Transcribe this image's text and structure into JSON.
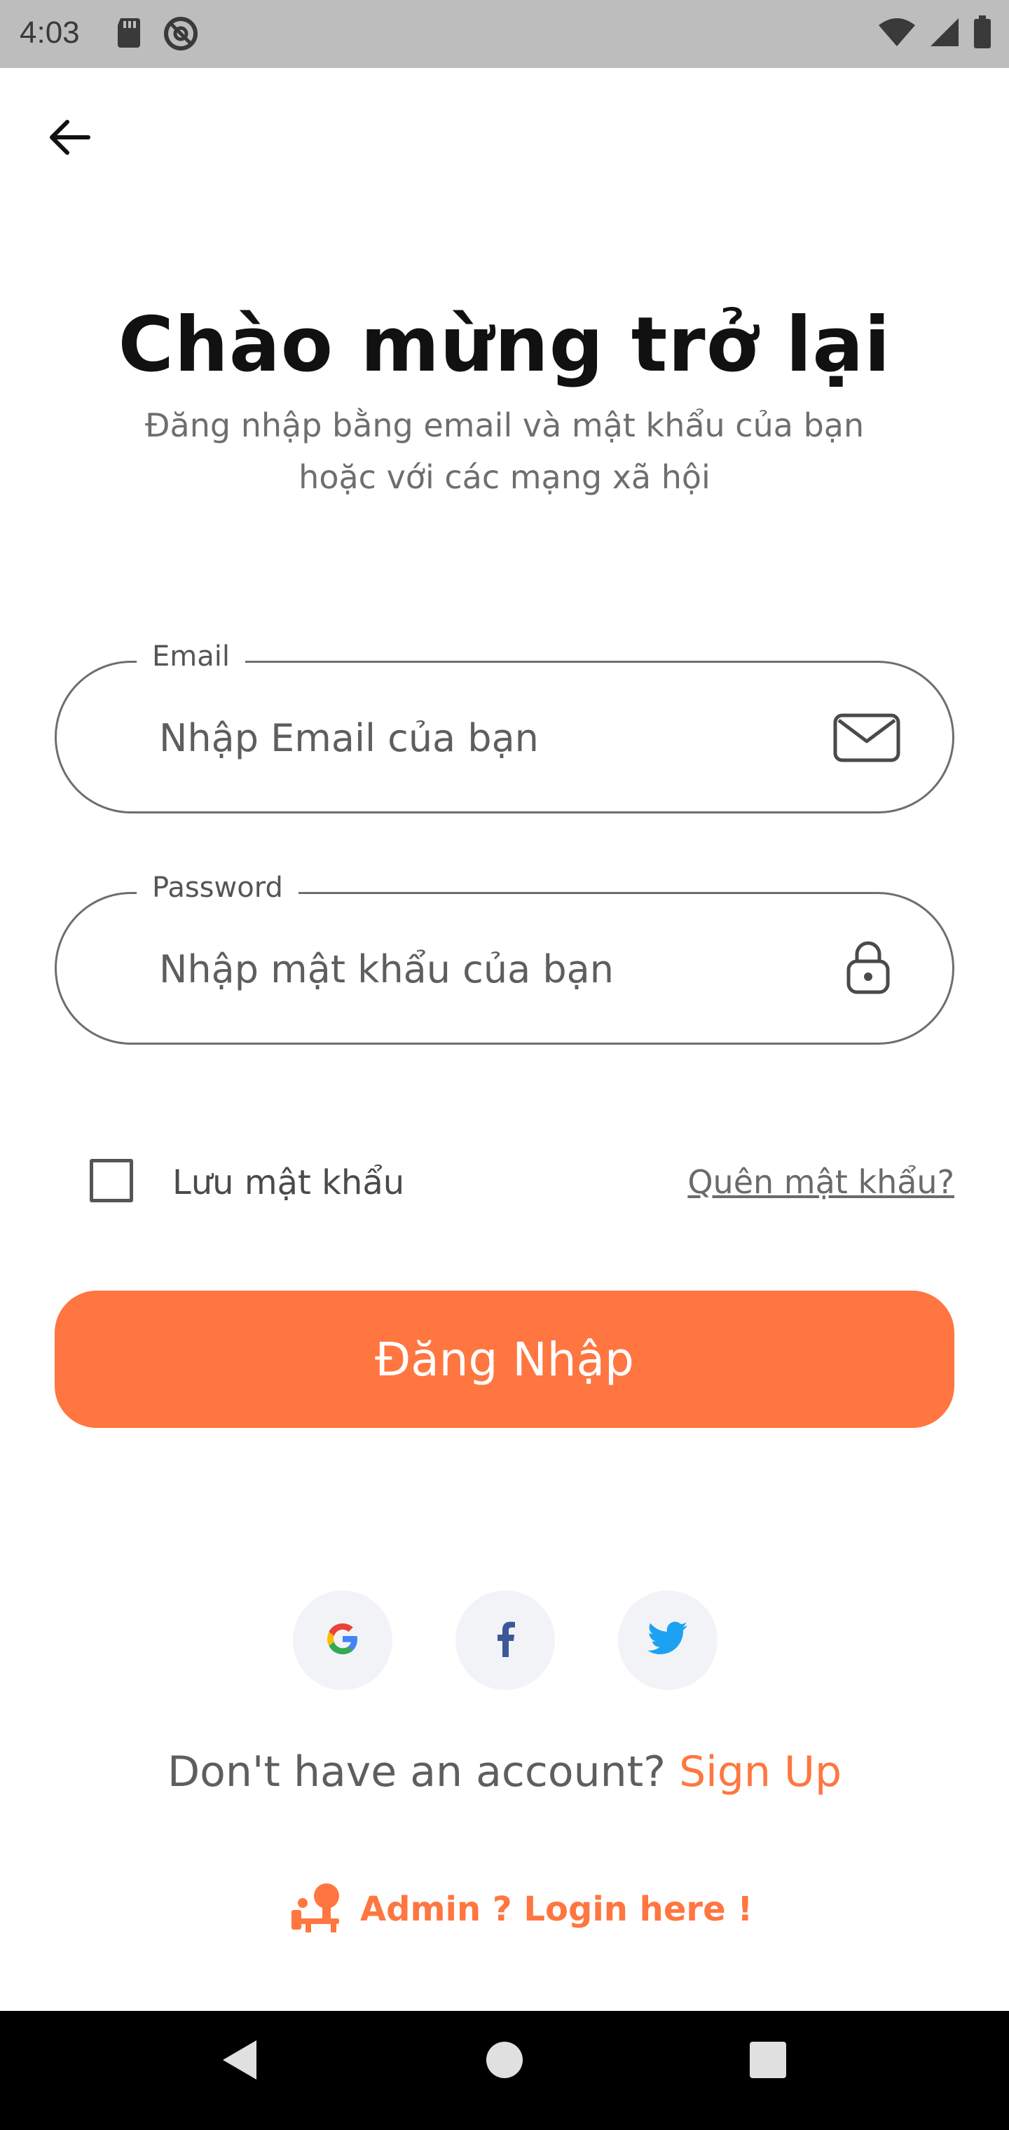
{
  "status_bar": {
    "time": "4:03",
    "icons": [
      "sd-card-icon",
      "no-disturb-icon",
      "wifi-icon",
      "signal-icon",
      "battery-icon"
    ]
  },
  "header": {
    "back_icon": "arrow-left-icon",
    "title": "Chào mừng trở lại",
    "subtitle": "Đăng nhập bằng email và mật khẩu của bạn hoặc với các mạng xã hội"
  },
  "form": {
    "email": {
      "label": "Email",
      "placeholder": "Nhập Email của bạn",
      "value": "",
      "icon": "mail-icon"
    },
    "password": {
      "label": "Password",
      "placeholder": "Nhập mật khẩu của bạn",
      "value": "",
      "icon": "lock-icon"
    },
    "remember_label": "Lưu mật khẩu",
    "remember_checked": false,
    "forgot_label": "Quên mật khẩu?",
    "submit_label": "Đăng Nhập"
  },
  "social": {
    "providers": [
      "google-icon",
      "facebook-icon",
      "twitter-icon"
    ]
  },
  "signup": {
    "question": "Don't have an account?",
    "link": "Sign Up"
  },
  "admin": {
    "label": "Admin ? Login here !",
    "icon": "admin-icon"
  },
  "colors": {
    "accent": "#ff7640",
    "status_bar": "#bdbdbd",
    "nav_bar": "#000000",
    "social_bg": "#f2f3f7"
  }
}
